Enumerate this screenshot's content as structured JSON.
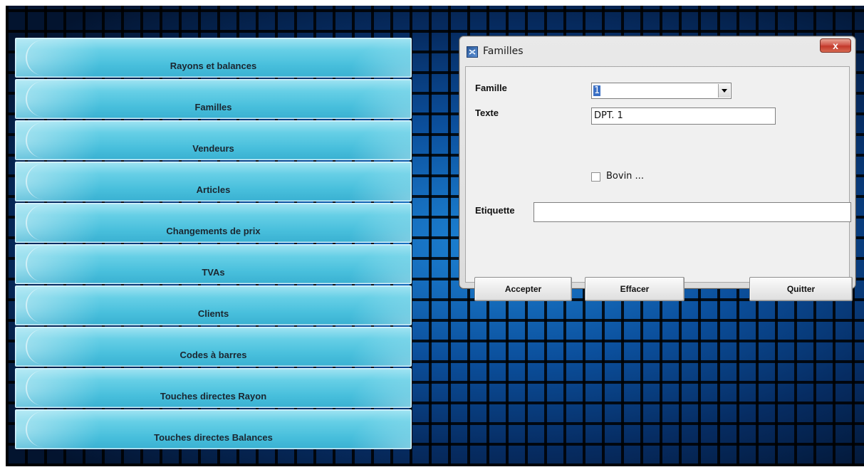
{
  "menu": {
    "items": [
      {
        "label": "Rayons et balances"
      },
      {
        "label": "Familles"
      },
      {
        "label": "Vendeurs"
      },
      {
        "label": "Articles"
      },
      {
        "label": "Changements de prix"
      },
      {
        "label": "TVAs"
      },
      {
        "label": "Clients"
      },
      {
        "label": "Codes à barres"
      },
      {
        "label": "Touches directes Rayon"
      },
      {
        "label": "Touches directes Balances"
      }
    ]
  },
  "dialog": {
    "title": "Familles",
    "close_label": "x",
    "famille": {
      "label": "Famille",
      "value": "1"
    },
    "texte": {
      "label": "Texte",
      "value": "DPT. 1"
    },
    "bovin": {
      "label": "Bovin ...",
      "checked": false
    },
    "etiquette": {
      "label": "Etiquette",
      "value": ""
    },
    "buttons": {
      "accept": "Accepter",
      "clear": "Effacer",
      "quit": "Quitter"
    }
  },
  "colors": {
    "menu_button": "#4fc3de",
    "background": "#0b4f9c",
    "selection": "#3a6fc4",
    "close_button": "#c8402f"
  }
}
